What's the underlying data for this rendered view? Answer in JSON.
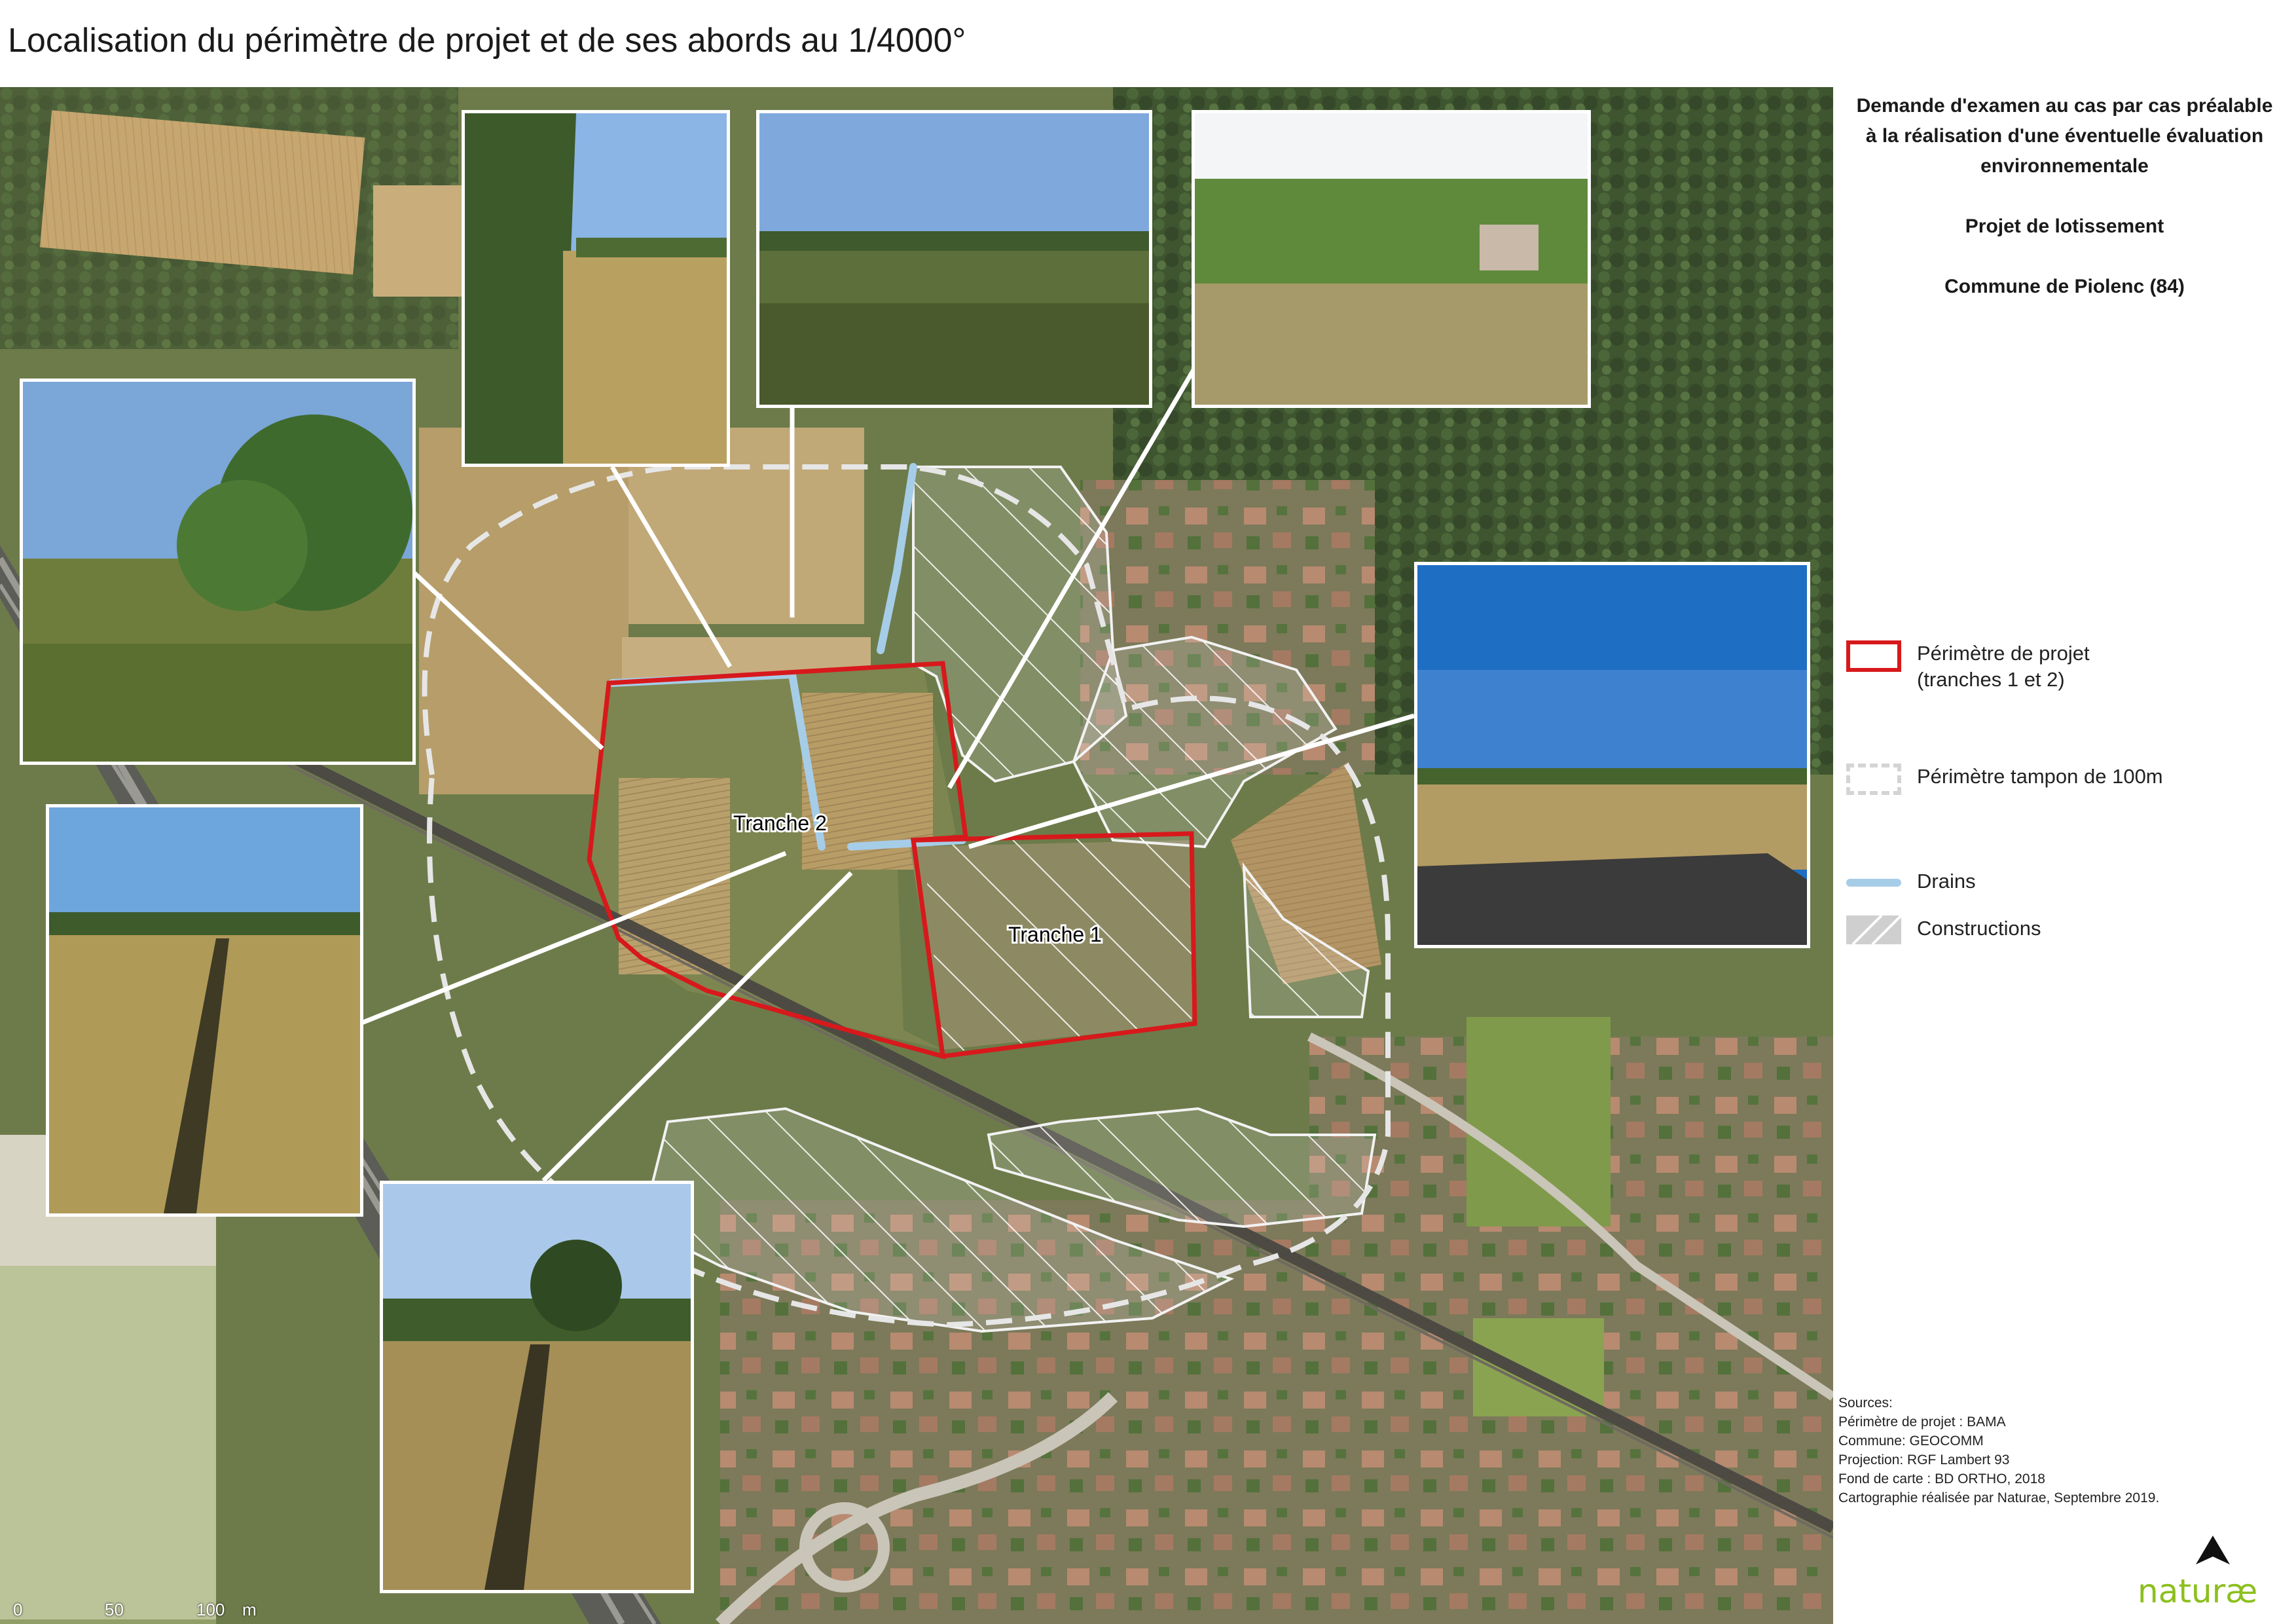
{
  "title": "Localisation du périmètre de projet et de ses abords au 1/4000°",
  "request": {
    "lines": [
      "Demande d'examen au cas par cas préalable",
      "à la réalisation d'une éventuelle évaluation",
      "environnementale"
    ],
    "project": "Projet de lotissement",
    "commune": "Commune de Piolenc (84)"
  },
  "legend": [
    {
      "label": "Périmètre de projet",
      "sublabel": "(tranches 1 et 2)",
      "style": "solid-red",
      "color": "#d7191c"
    },
    {
      "label": "Périmètre tampon de 100m",
      "sublabel": "",
      "style": "dashed-grey",
      "color": "#cccccc"
    },
    {
      "label": "Drains",
      "sublabel": "",
      "style": "line-blue",
      "color": "#a6cde8"
    },
    {
      "label": "Constructions",
      "sublabel": "",
      "style": "hatched",
      "color": "#bfbfbf"
    }
  ],
  "map_labels": {
    "tranche2": "Tranche 2",
    "tranche1": "Tranche 1"
  },
  "scale": {
    "labels": [
      "0",
      "50",
      "100",
      "m"
    ]
  },
  "sources": {
    "heading": "Sources:",
    "lines": [
      "Périmètre de projet : BAMA",
      "Commune: GEOCOMM",
      "Projection: RGF Lambert 93",
      "Fond de carte : BD ORTHO, 2018",
      "Cartographie réalisée par Naturae, Septembre 2019."
    ]
  },
  "logo_text": "naturæ",
  "colors": {
    "project_perimeter": "#d7191c",
    "buffer": "#e6e6e6",
    "drains": "#a6cde8",
    "logo_green": "#8cbf1f"
  }
}
